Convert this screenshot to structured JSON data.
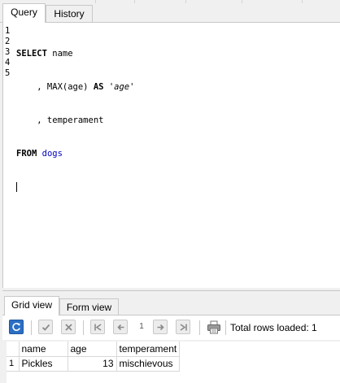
{
  "top_tabs": {
    "query": "Query",
    "history": "History"
  },
  "editor": {
    "line_numbers": [
      "1",
      "2",
      "3",
      "4",
      "5"
    ],
    "lines": [
      {
        "kw": "SELECT",
        "rest": " name"
      },
      {
        "pre": "    , MAX(age) ",
        "kw": "AS",
        "mid": " ",
        "str": "'age'"
      },
      {
        "pre": "    , temperament"
      },
      {
        "kw": "FROM",
        "mid": " ",
        "tbl": "dogs"
      },
      {
        "pre": ""
      }
    ]
  },
  "bottom_tabs": {
    "grid": "Grid view",
    "form": "Form view"
  },
  "toolbar": {
    "page": "1",
    "rows_loaded": "Total rows loaded: 1",
    "icons": [
      "refresh-icon",
      "apply-icon",
      "cancel-icon",
      "first-page-icon",
      "prev-page-icon",
      "next-page-icon",
      "last-page-icon",
      "print-icon"
    ]
  },
  "grid": {
    "columns": [
      "name",
      "age",
      "temperament"
    ],
    "rows": [
      {
        "num": "1",
        "name": "Pickles",
        "age": "13",
        "temperament": "mischievous"
      }
    ]
  },
  "colors": {
    "keyword": "#000000",
    "table": "#0000c0",
    "refresh_button": "#2b6fc4"
  }
}
